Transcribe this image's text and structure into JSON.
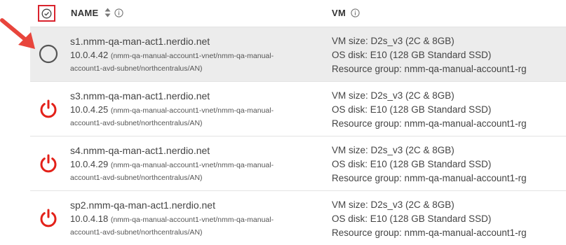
{
  "header": {
    "name_label": "NAME",
    "vm_label": "VM"
  },
  "colors": {
    "highlight_red": "#d9232d",
    "power_red": "#e32119",
    "selected_row_bg": "#ececec"
  },
  "rows": [
    {
      "status_icon": "radio-unselected-icon",
      "host": "s1.nmm-qa-man-act1.nerdio.net",
      "ip": "10.0.4.42",
      "path_line1": "(nmm-qa-manual-account1-vnet/nmm-qa-manual-",
      "path_line2": "account1-avd-subnet/northcentralus/AN)",
      "vm_size": "VM size: D2s_v3 (2C & 8GB)",
      "os_disk": "OS disk: E10 (128 GB Standard SSD)",
      "resource_group": "Resource group: nmm-qa-manual-account1-rg"
    },
    {
      "status_icon": "power-icon",
      "host": "s3.nmm-qa-man-act1.nerdio.net",
      "ip": "10.0.4.25",
      "path_line1": "(nmm-qa-manual-account1-vnet/nmm-qa-manual-",
      "path_line2": "account1-avd-subnet/northcentralus/AN)",
      "vm_size": "VM size: D2s_v3 (2C & 8GB)",
      "os_disk": "OS disk: E10 (128 GB Standard SSD)",
      "resource_group": "Resource group: nmm-qa-manual-account1-rg"
    },
    {
      "status_icon": "power-icon",
      "host": "s4.nmm-qa-man-act1.nerdio.net",
      "ip": "10.0.4.29",
      "path_line1": "(nmm-qa-manual-account1-vnet/nmm-qa-manual-",
      "path_line2": "account1-avd-subnet/northcentralus/AN)",
      "vm_size": "VM size: D2s_v3 (2C & 8GB)",
      "os_disk": "OS disk: E10 (128 GB Standard SSD)",
      "resource_group": "Resource group: nmm-qa-manual-account1-rg"
    },
    {
      "status_icon": "power-icon",
      "host": "sp2.nmm-qa-man-act1.nerdio.net",
      "ip": "10.0.4.18",
      "path_line1": "(nmm-qa-manual-account1-vnet/nmm-qa-manual-",
      "path_line2": "account1-avd-subnet/northcentralus/AN)",
      "vm_size": "VM size: D2s_v3 (2C & 8GB)",
      "os_disk": "OS disk: E10 (128 GB Standard SSD)",
      "resource_group": "Resource group: nmm-qa-manual-account1-rg"
    }
  ]
}
